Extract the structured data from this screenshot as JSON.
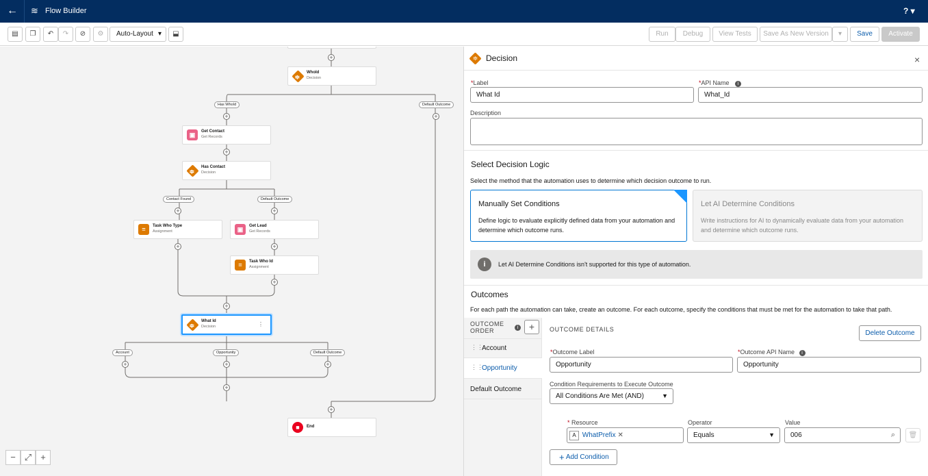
{
  "app": {
    "title": "Flow Builder",
    "help": "?"
  },
  "toolbar": {
    "layout_select": "Auto-Layout",
    "run": "Run",
    "debug": "Debug",
    "view_tests": "View Tests",
    "save_as_new": "Save As New Version",
    "save": "Save",
    "activate": "Activate"
  },
  "canvas": {
    "nodes": [
      {
        "name": "WhoId",
        "type": "Decision"
      },
      {
        "name": "Get Contact",
        "type": "Get Records"
      },
      {
        "name": "Has Contact",
        "type": "Decision"
      },
      {
        "name": "Task Who Type",
        "type": "Assignment"
      },
      {
        "name": "Get Lead",
        "type": "Get Records"
      },
      {
        "name": "Task Who Id",
        "type": "Assignment"
      },
      {
        "name": "What Id",
        "type": "Decision"
      },
      {
        "name": "End",
        "type": ""
      }
    ],
    "branches": [
      "Has WhoId",
      "Default Outcome",
      "Contact Found",
      "Default Outcome",
      "Account",
      "Opportunity",
      "Default Outcome"
    ]
  },
  "panel": {
    "header": "Decision",
    "label_label": "Label",
    "label_value": "What Id",
    "api_label": "API Name",
    "api_value": "What_Id",
    "description_label": "Description",
    "logic_title": "Select Decision Logic",
    "logic_desc": "Select the method that the automation uses to determine which decision outcome to run.",
    "manual_title": "Manually Set Conditions",
    "manual_desc": "Define logic to evaluate explicitly defined data from your automation and determine which outcome runs.",
    "ai_title": "Let AI Determine Conditions",
    "ai_desc": "Write instructions for AI to dynamically evaluate data from your automation and determine which outcome runs.",
    "ai_notice": "Let AI Determine Conditions isn't supported for this type of automation.",
    "outcomes_title": "Outcomes",
    "outcomes_desc": "For each path the automation can take, create an outcome. For each outcome, specify the conditions that must be met for the automation to take that path.",
    "outcome_order": "OUTCOME ORDER",
    "outcomes": [
      "Account",
      "Opportunity",
      "Default Outcome"
    ],
    "details_title": "OUTCOME DETAILS",
    "delete_outcome": "Delete Outcome",
    "outcome_label_label": "Outcome Label",
    "outcome_label_value": "Opportunity",
    "outcome_api_label": "Outcome API Name",
    "outcome_api_value": "Opportunity",
    "cond_req_label": "Condition Requirements to Execute Outcome",
    "cond_req_value": "All Conditions Are Met (AND)",
    "resource_label": "Resource",
    "resource_value": "WhatPrefix",
    "operator_label": "Operator",
    "operator_value": "Equals",
    "value_label": "Value",
    "value_value": "006",
    "add_condition": "Add Condition"
  }
}
